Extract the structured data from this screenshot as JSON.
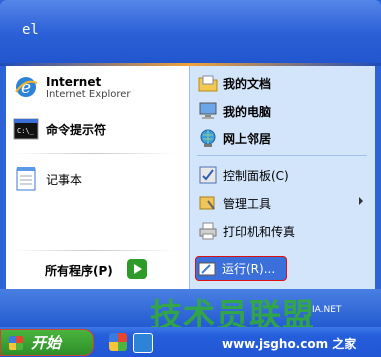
{
  "header": {
    "user_name": "el"
  },
  "left": {
    "pinned": [
      {
        "title": "Internet",
        "subtitle": "Internet Explorer",
        "icon": "internet-explorer-icon"
      },
      {
        "title": "命令提示符",
        "icon": "command-prompt-icon"
      }
    ],
    "recent": [
      {
        "title": "记事本",
        "icon": "notepad-icon"
      }
    ],
    "all_programs": "所有程序(P)"
  },
  "right": {
    "items": [
      {
        "label": "我的文档",
        "icon": "my-documents-icon"
      },
      {
        "label": "我的电脑",
        "icon": "my-computer-icon"
      },
      {
        "label": "网上邻居",
        "icon": "network-places-icon"
      },
      {
        "label": "控制面板(C)",
        "icon": "control-panel-icon"
      },
      {
        "label": "管理工具",
        "icon": "admin-tools-icon"
      },
      {
        "label": "打印机和传真",
        "icon": "printers-icon"
      },
      {
        "label": "运行(R)...",
        "icon": "run-icon"
      }
    ]
  },
  "taskbar": {
    "start_label": "开始"
  },
  "watermark": {
    "text": "技术员联盟",
    "url": "www.jsgho.com",
    "suffix": "之家",
    "partial": "IA.NET"
  },
  "colors": {
    "accent": "#2c64d8",
    "start_green": "#2e8f2a",
    "highlight_red": "#d11111",
    "watermark_green": "#31b02f"
  }
}
